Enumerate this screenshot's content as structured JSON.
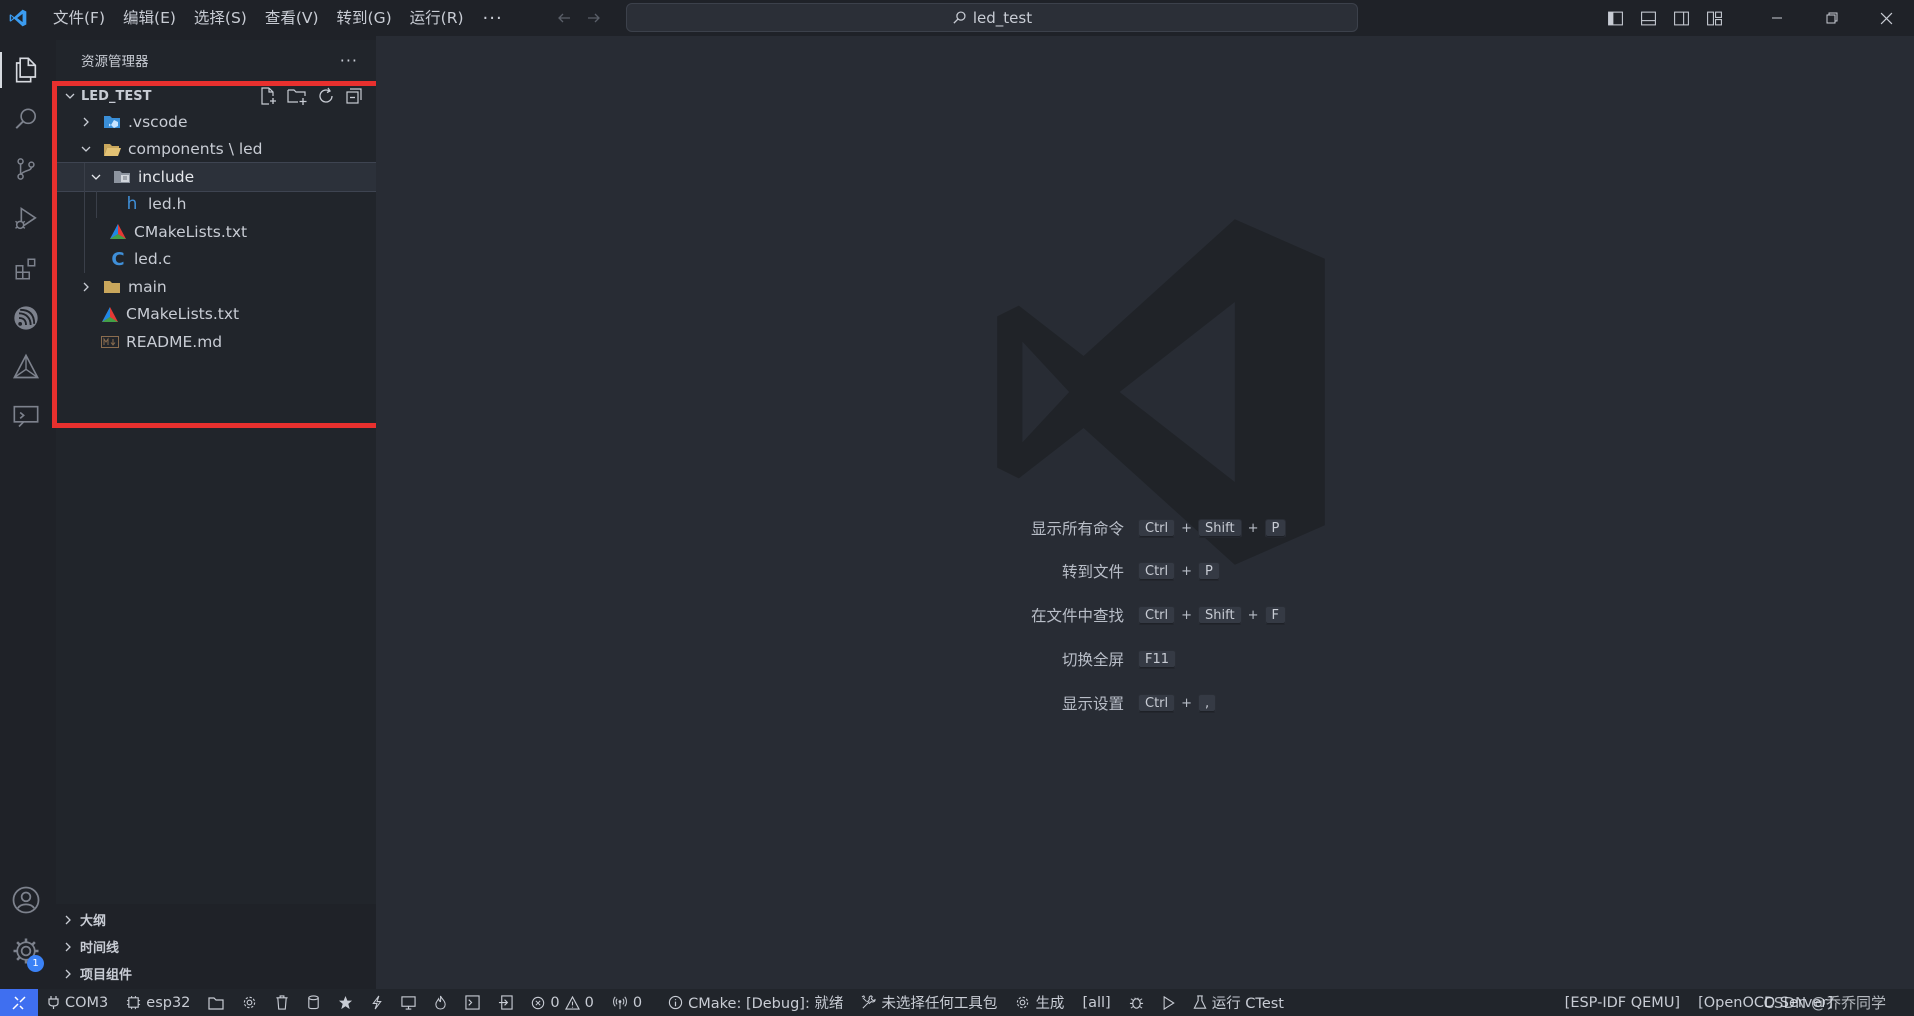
{
  "window": {
    "search_text": "led_test"
  },
  "menu": [
    "文件(F)",
    "编辑(E)",
    "选择(S)",
    "查看(V)",
    "转到(G)",
    "运行(R)"
  ],
  "menu_more": "···",
  "sidebar": {
    "title": "资源管理器",
    "more": "···",
    "root_label": "LED_TEST",
    "tree": [
      {
        "label": ".vscode"
      },
      {
        "label": "components \\ led"
      },
      {
        "label": "include"
      },
      {
        "label": "led.h"
      },
      {
        "label": "CMakeLists.txt"
      },
      {
        "label": "led.c"
      },
      {
        "label": "main"
      },
      {
        "label": "CMakeLists.txt"
      },
      {
        "label": "README.md"
      }
    ],
    "bottom_sections": [
      "大纲",
      "时间线",
      "项目组件"
    ]
  },
  "activity": {
    "settings_badge": "1"
  },
  "shortcuts": [
    {
      "label": "显示所有命令",
      "keys": [
        "Ctrl",
        "Shift",
        "P"
      ]
    },
    {
      "label": "转到文件",
      "keys": [
        "Ctrl",
        "P"
      ]
    },
    {
      "label": "在文件中查找",
      "keys": [
        "Ctrl",
        "Shift",
        "F"
      ]
    },
    {
      "label": "切换全屏",
      "keys": [
        "F11"
      ]
    },
    {
      "label": "显示设置",
      "keys": [
        "Ctrl",
        ","
      ]
    }
  ],
  "statusbar": {
    "port": "COM3",
    "target": "esp32",
    "errors": "0",
    "warnings": "0",
    "ports_count": "0",
    "cmake": "CMake: [Debug]: 就绪",
    "kit": "未选择任何工具包",
    "build": "生成",
    "all": "[all]",
    "ctest": "运行 CTest",
    "qemu": "[ESP-IDF QEMU]",
    "openocd": "[OpenOCD Server]",
    "watermark": "CSDN @乔乔同学"
  }
}
